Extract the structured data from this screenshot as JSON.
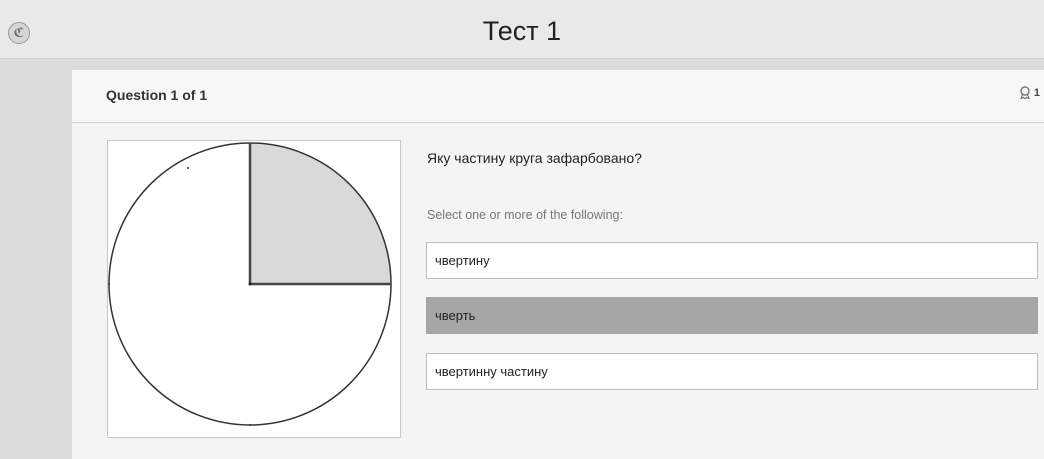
{
  "app": {
    "logo_glyph": "ℭ",
    "title": "Тест 1"
  },
  "question": {
    "header": "Question 1 of 1",
    "points": "1",
    "prompt": "Яку частину круга зафарбовано?",
    "instruction": "Select one or more of the following:",
    "figure": {
      "shaded_fraction": 0.25,
      "shaded_color": "#d9d9d9"
    },
    "options": [
      {
        "label": "чвертину",
        "selected": false
      },
      {
        "label": "чверть",
        "selected": true
      },
      {
        "label": "чвертинну частину",
        "selected": false
      }
    ]
  },
  "colors": {
    "selected_bg": "#a6a6a6",
    "page_bg": "#dcdcdc"
  }
}
